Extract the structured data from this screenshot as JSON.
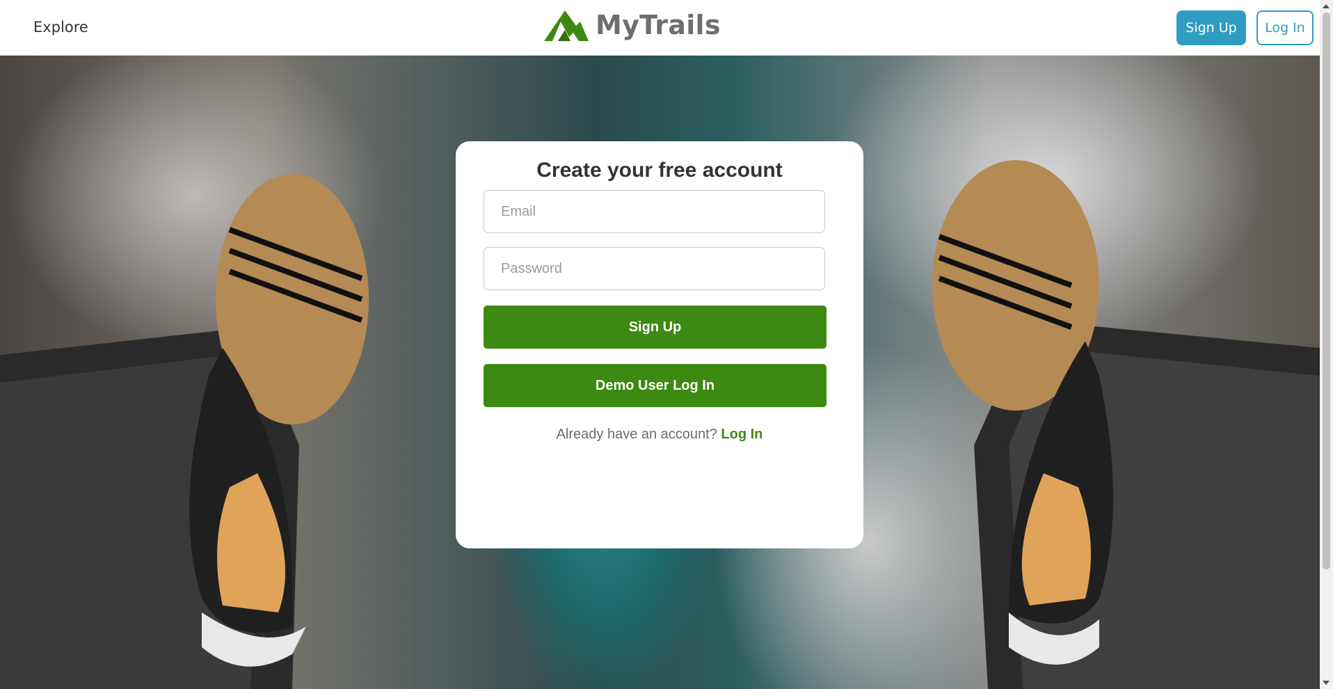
{
  "header": {
    "explore_label": "Explore",
    "brand": "MyTrails",
    "signup_label": "Sign Up",
    "login_label": "Log In"
  },
  "card": {
    "title": "Create your free account",
    "email_placeholder": "Email",
    "password_placeholder": "Password",
    "signup_button": "Sign Up",
    "demo_button": "Demo User Log In",
    "already_text": "Already have an account?",
    "login_link": "Log In"
  },
  "colors": {
    "brand_green": "#3d8a12",
    "header_blue": "#2e9dc0",
    "logo_gray": "#6e6e6e"
  },
  "icons": {
    "logo": "mountain-icon"
  }
}
